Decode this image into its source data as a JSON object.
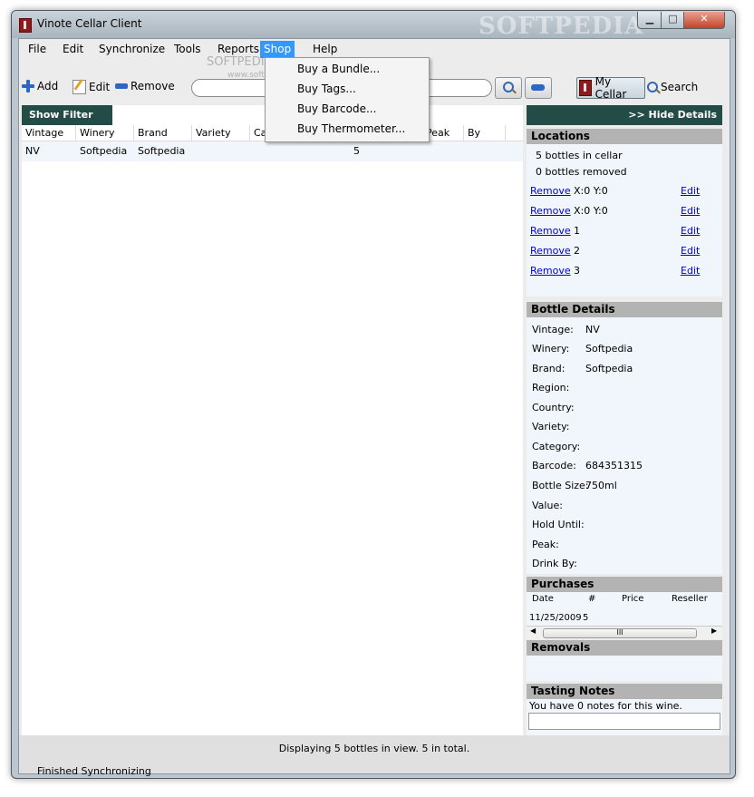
{
  "window": {
    "title": "Vinote Cellar Client",
    "watermark": "SOFTPEDIA",
    "watermark2": "SOFTPEDIA",
    "watermark3": "www.softpedia.com",
    "min": "▁",
    "max": "□",
    "close": "✕"
  },
  "menu": {
    "file": "File",
    "edit": "Edit",
    "synchronize": "Synchronize",
    "tools": "Tools",
    "reports": "Reports",
    "shop": "Shop",
    "help": "Help"
  },
  "shop_menu": [
    "Buy a Bundle...",
    "Buy Tags...",
    "Buy Barcode...",
    "Buy Thermometer..."
  ],
  "toolbar": {
    "add": "Add",
    "edit": "Edit",
    "remove": "Remove",
    "my_cellar": "My Cellar",
    "search": "Search",
    "search_value": ""
  },
  "filter": {
    "label": "Show Filter >>"
  },
  "table": {
    "columns": [
      "Vintage",
      "Winery",
      "Brand",
      "Variety",
      "Ca",
      "Peak",
      "By"
    ],
    "rows": [
      {
        "vintage": "NV",
        "winery": "Softpedia",
        "brand": "Softpedia",
        "qty": "5"
      }
    ]
  },
  "details": {
    "hide": ">> Hide Details",
    "locations": {
      "title": "Locations",
      "in_cellar": "5 bottles in cellar",
      "removed": "0 bottles removed",
      "remove_label": "Remove",
      "edit_label": "Edit",
      "items": [
        "X:0 Y:0",
        "X:0 Y:0",
        "1",
        "2",
        "3"
      ]
    },
    "bottle": {
      "title": "Bottle Details",
      "vintage_l": "Vintage:",
      "vintage_v": "NV",
      "winery_l": "Winery:",
      "winery_v": "Softpedia",
      "brand_l": "Brand:",
      "brand_v": "Softpedia",
      "region_l": "Region:",
      "country_l": "Country:",
      "variety_l": "Variety:",
      "category_l": "Category:",
      "barcode_l": "Barcode:",
      "barcode_v": "684351315",
      "size_l": "Bottle Size:",
      "size_v": "750ml",
      "value_l": "Value:",
      "hold_l": "Hold Until:",
      "peak_l": "Peak:",
      "drink_l": "Drink By:"
    },
    "purchases": {
      "title": "Purchases",
      "columns": [
        "Date",
        "#",
        "Price",
        "Reseller"
      ],
      "row": {
        "date": "11/25/2009",
        "qty": "5"
      },
      "scroll_thumb": "III"
    },
    "removals": {
      "title": "Removals"
    },
    "tasting": {
      "title": "Tasting Notes",
      "text": "You have 0 notes for this wine."
    }
  },
  "status": {
    "displaying": "Displaying 5 bottles in view. 5 in total.",
    "sync": "Finished Synchronizing"
  }
}
